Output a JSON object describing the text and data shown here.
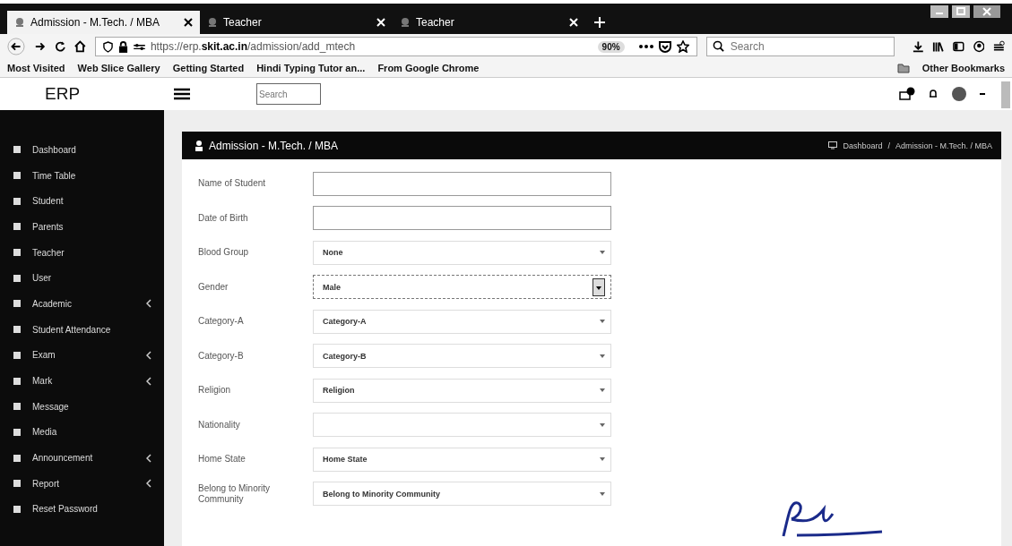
{
  "tabs": [
    {
      "title": "Admission - M.Tech. / MBA",
      "selected": true
    },
    {
      "title": "Teacher",
      "selected": false
    },
    {
      "title": "Teacher",
      "selected": false
    }
  ],
  "address": {
    "url_prefix": "https://erp.",
    "url_domain": "skit.ac.in",
    "url_path": "/admission/add_mtech",
    "zoom": "90%"
  },
  "browser_search": {
    "placeholder": "Search"
  },
  "bookmarks": [
    "Most Visited",
    "Web Slice Gallery",
    "Getting Started",
    "Hindi Typing Tutor an...",
    "From Google Chrome"
  ],
  "other_bookmarks": "Other Bookmarks",
  "app": {
    "logo": "ERP",
    "search": {
      "placeholder": "Search"
    }
  },
  "sidebar": {
    "items": [
      {
        "label": "Dashboard",
        "has_submenu": false
      },
      {
        "label": "Time Table",
        "has_submenu": false
      },
      {
        "label": "Student",
        "has_submenu": false
      },
      {
        "label": "Parents",
        "has_submenu": false
      },
      {
        "label": "Teacher",
        "has_submenu": false
      },
      {
        "label": "User",
        "has_submenu": false
      },
      {
        "label": "Academic",
        "has_submenu": true
      },
      {
        "label": "Student Attendance",
        "has_submenu": false
      },
      {
        "label": "Exam",
        "has_submenu": true
      },
      {
        "label": "Mark",
        "has_submenu": true
      },
      {
        "label": "Message",
        "has_submenu": false
      },
      {
        "label": "Media",
        "has_submenu": false
      },
      {
        "label": "Announcement",
        "has_submenu": true
      },
      {
        "label": "Report",
        "has_submenu": true
      },
      {
        "label": "Reset Password",
        "has_submenu": false
      }
    ]
  },
  "panel": {
    "title": "Admission - M.Tech. / MBA",
    "breadcrumb": [
      "Dashboard",
      "Admission - M.Tech. / MBA"
    ],
    "breadcrumb_separator": "/"
  },
  "form": [
    {
      "label": "Name of Student",
      "kind": "text",
      "focused": false
    },
    {
      "label": "Date of Birth",
      "kind": "text",
      "focused": false
    },
    {
      "label": "Blood Group",
      "kind": "select",
      "value": "None",
      "focused": false
    },
    {
      "label": "Gender",
      "kind": "select",
      "value": "Male",
      "focused": true
    },
    {
      "label": "Category-A",
      "kind": "select",
      "value": "Category-A",
      "focused": false
    },
    {
      "label": "Category-B",
      "kind": "select",
      "value": "Category-B",
      "focused": false
    },
    {
      "label": "Religion",
      "kind": "select",
      "value": "Religion",
      "focused": false
    },
    {
      "label": "Nationality",
      "kind": "select",
      "focused": false
    },
    {
      "label": "Home State",
      "kind": "select",
      "value": "Home State",
      "focused": false
    },
    {
      "label": "Belong to Minority Community",
      "kind": "select",
      "value": "Belong to Minority Community",
      "focused": false
    }
  ]
}
